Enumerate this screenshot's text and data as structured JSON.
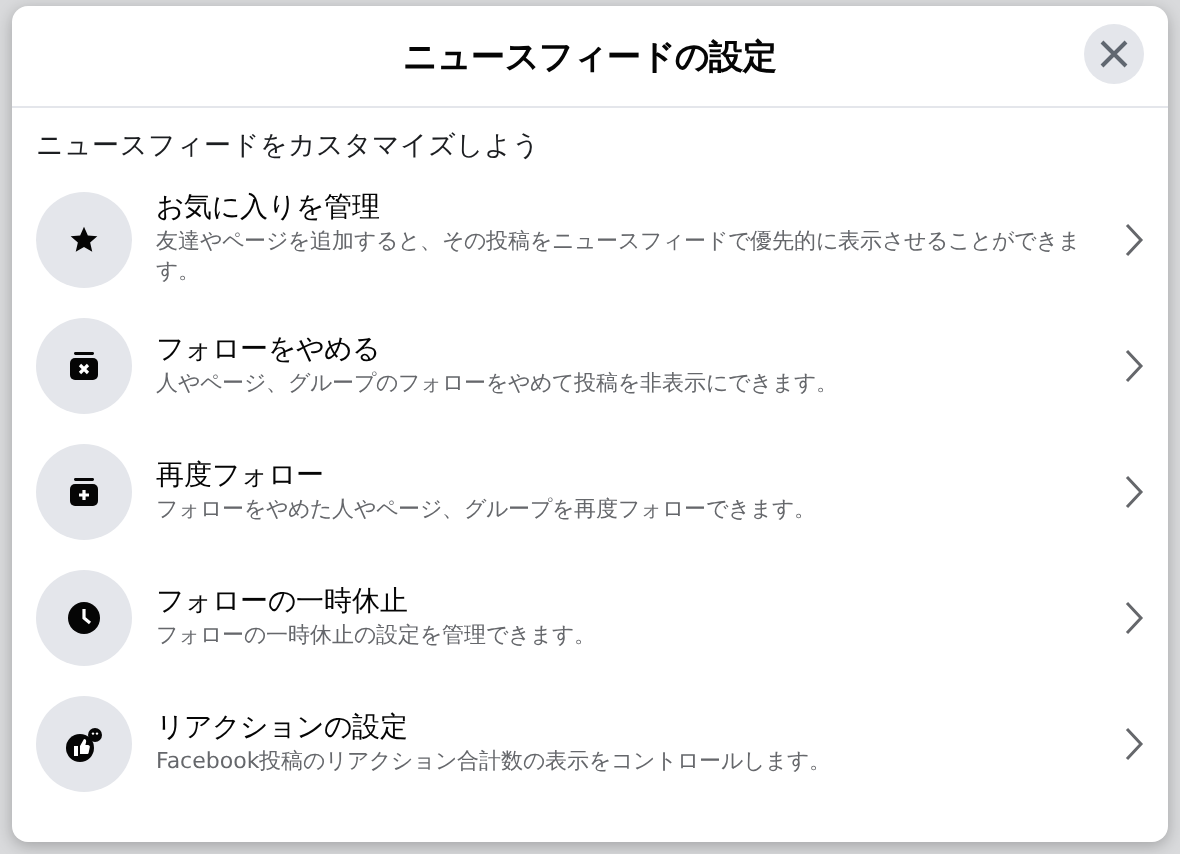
{
  "dialog": {
    "title": "ニュースフィードの設定",
    "subtitle": "ニュースフィードをカスタマイズしよう",
    "items": [
      {
        "title": "お気に入りを管理",
        "description": "友達やページを追加すると、その投稿をニュースフィードで優先的に表示させることができます。"
      },
      {
        "title": "フォローをやめる",
        "description": "人やページ、グループのフォローをやめて投稿を非表示にできます。"
      },
      {
        "title": "再度フォロー",
        "description": "フォローをやめた人やページ、グループを再度フォローできます。"
      },
      {
        "title": "フォローの一時休止",
        "description": "フォローの一時休止の設定を管理できます。"
      },
      {
        "title": "リアクションの設定",
        "description": "Facebook投稿のリアクション合計数の表示をコントロールします。"
      }
    ]
  }
}
